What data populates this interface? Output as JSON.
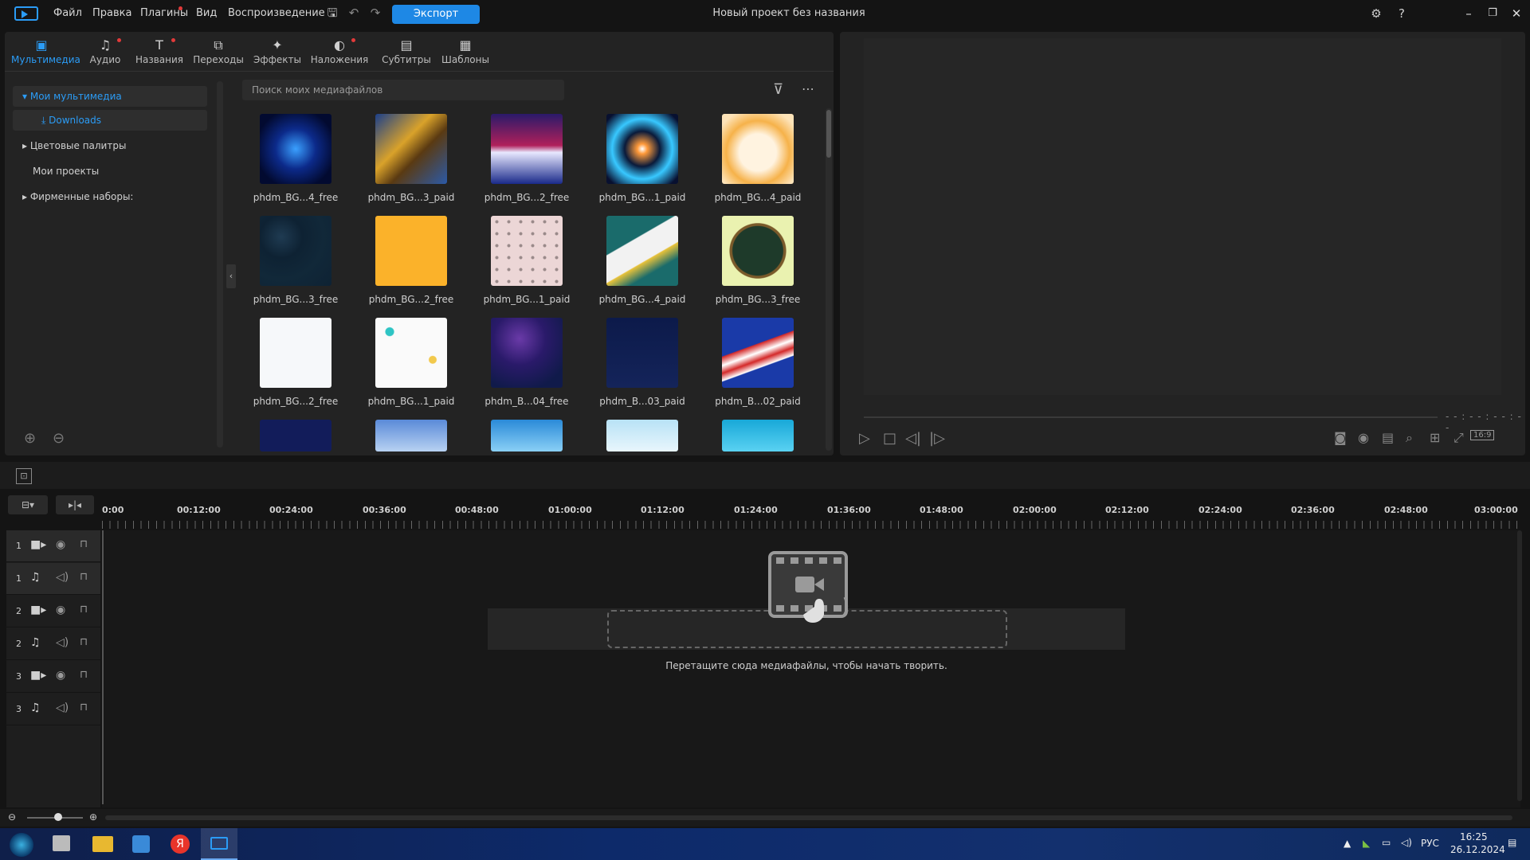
{
  "titlebar": {
    "menu": [
      {
        "label": "Файл"
      },
      {
        "label": "Правка"
      },
      {
        "label": "Плагины"
      },
      {
        "label": "Вид"
      },
      {
        "label": "Воспроизведение"
      }
    ],
    "export_label": "Экспорт",
    "project_title": "Новый проект без названия"
  },
  "library": {
    "tabs": [
      {
        "label": "Мультимедиа",
        "icon": "media-icon",
        "active": true
      },
      {
        "label": "Аудио",
        "icon": "music-note-icon"
      },
      {
        "label": "Названия",
        "icon": "text-icon"
      },
      {
        "label": "Переходы",
        "icon": "transition-icon"
      },
      {
        "label": "Эффекты",
        "icon": "effects-icon"
      },
      {
        "label": "Наложения",
        "icon": "overlay-icon"
      },
      {
        "label": "Субтитры",
        "icon": "subtitles-icon"
      },
      {
        "label": "Шаблоны",
        "icon": "templates-icon"
      }
    ],
    "tree": [
      {
        "label": "Мои мультимедиа"
      },
      {
        "label": "Downloads"
      },
      {
        "label": "Цветовые палитры"
      },
      {
        "label": "Мои проекты"
      },
      {
        "label": "Фирменные наборы:"
      }
    ],
    "search_placeholder": "Поиск моих медиафайлов",
    "items": [
      {
        "label": "phdm_BG...4_free"
      },
      {
        "label": "phdm_BG...3_paid"
      },
      {
        "label": "phdm_BG...2_free"
      },
      {
        "label": "phdm_BG...1_paid"
      },
      {
        "label": "phdm_BG...4_paid"
      },
      {
        "label": "phdm_BG...3_free"
      },
      {
        "label": "phdm_BG...2_free"
      },
      {
        "label": "phdm_BG...1_paid"
      },
      {
        "label": "phdm_BG...4_paid"
      },
      {
        "label": "phdm_BG...3_free"
      },
      {
        "label": "phdm_BG...2_free"
      },
      {
        "label": "phdm_BG...1_paid"
      },
      {
        "label": "phdm_B...04_free"
      },
      {
        "label": "phdm_B...03_paid"
      },
      {
        "label": "phdm_B...02_paid"
      },
      {
        "label": ""
      },
      {
        "label": ""
      },
      {
        "label": ""
      },
      {
        "label": ""
      },
      {
        "label": ""
      }
    ]
  },
  "preview": {
    "time": "- - : - - : - - : - -",
    "aspect": "16:9"
  },
  "timeline": {
    "ruler": [
      "0:00",
      "00:12:00",
      "00:24:00",
      "00:36:00",
      "00:48:00",
      "01:00:00",
      "01:12:00",
      "01:24:00",
      "01:36:00",
      "01:48:00",
      "02:00:00",
      "02:12:00",
      "02:24:00",
      "02:36:00",
      "02:48:00",
      "03:00:00"
    ],
    "tracks": [
      {
        "num": "1",
        "type": "video"
      },
      {
        "num": "1",
        "type": "audio"
      },
      {
        "num": "2",
        "type": "video"
      },
      {
        "num": "2",
        "type": "audio"
      },
      {
        "num": "3",
        "type": "video"
      },
      {
        "num": "3",
        "type": "audio"
      }
    ],
    "drop_hint": "Перетащите сюда медиафайлы, чтобы начать творить."
  },
  "taskbar": {
    "lang": "РУС",
    "time": "16:25",
    "date": "26.12.2024"
  },
  "colors": {
    "accent": "#2b9cf6",
    "export": "#1e88e5"
  }
}
